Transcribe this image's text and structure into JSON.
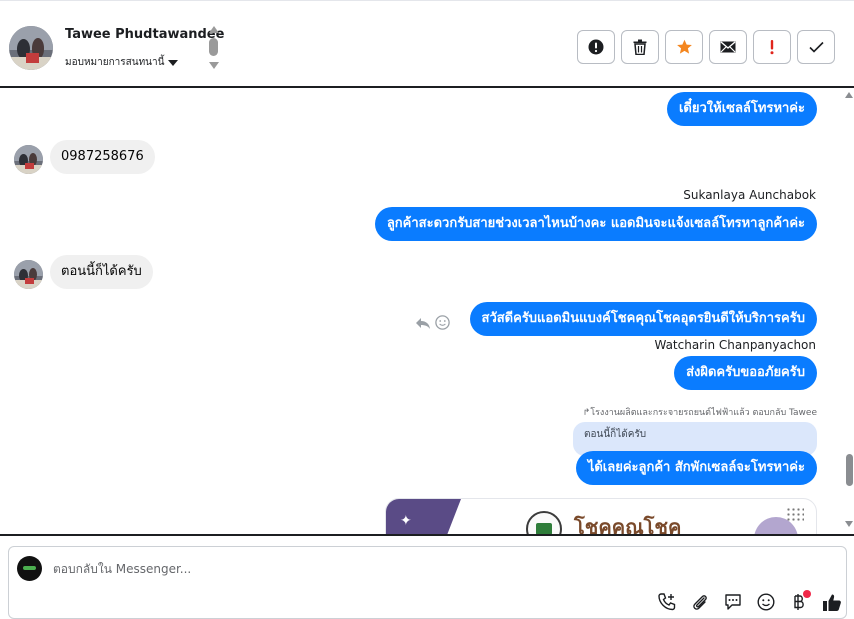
{
  "contact": {
    "name": "Tawee Phudtawandee",
    "assign_label": "มอบหมายการสนทนานี้"
  },
  "actions": [
    {
      "name": "spam-icon",
      "label": "!"
    },
    {
      "name": "trash-icon"
    },
    {
      "name": "star-icon"
    },
    {
      "name": "mail-icon"
    },
    {
      "name": "important-icon",
      "label": "!"
    },
    {
      "name": "check-icon"
    }
  ],
  "messages": {
    "m1": "เดี๋ยวให้เซลล์โทรหาค่ะ",
    "m2": "0987258676",
    "m3_sender": "Sukanlaya Aunchabok",
    "m3": "ลูกค้าสะดวกรับสายช่วงเวลาไหนบ้างคะ แอดมินจะแจ้งเซลล์โทรหาลูกค้าค่ะ",
    "m4": "ตอนนี้ก็ได้ครับ",
    "m5": "สวัสดีครับแอดมินแบงค์โชคคุณโชคอุดรยินดีให้บริการครับ",
    "m6_sender": "Watcharin Chanpanyachon",
    "m6": "ส่งผิดครับขออภัยครับ",
    "reply_note": "โรงงานผลิตและกระจายรถยนต์ไฟฟ้าแล้ว ตอบกลับ Tawee",
    "quoted": "ตอนนี้ก็ได้ครับ",
    "m7": "ได้เลยค่ะลูกค้า สักพักเซลล์จะโทรหาค่ะ",
    "card_brand": "โชคคุณโชค"
  },
  "composer": {
    "placeholder": "ตอบกลับใน Messenger..."
  },
  "colors": {
    "outgoing_bubble": "#0a7cff",
    "incoming_bubble": "#f0f0f0",
    "quoted_bubble": "#dbe7fb",
    "star": "#f4861f",
    "important": "#e0251c"
  }
}
